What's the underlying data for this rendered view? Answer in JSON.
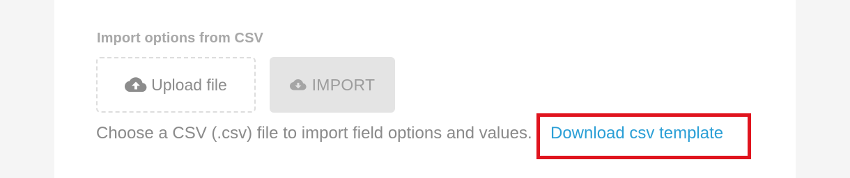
{
  "import_section": {
    "title": "Import options from CSV",
    "upload_button": {
      "label": "Upload file",
      "icon": "cloud-upload-icon"
    },
    "import_button": {
      "label": "IMPORT",
      "icon": "cloud-download-icon"
    },
    "help_text": "Choose a CSV (.csv) file to import field options and values.",
    "download_link": "Download csv template"
  },
  "colors": {
    "link": "#2b9fd6",
    "highlight": "#e0141e",
    "muted_text": "#8a8a8a"
  }
}
